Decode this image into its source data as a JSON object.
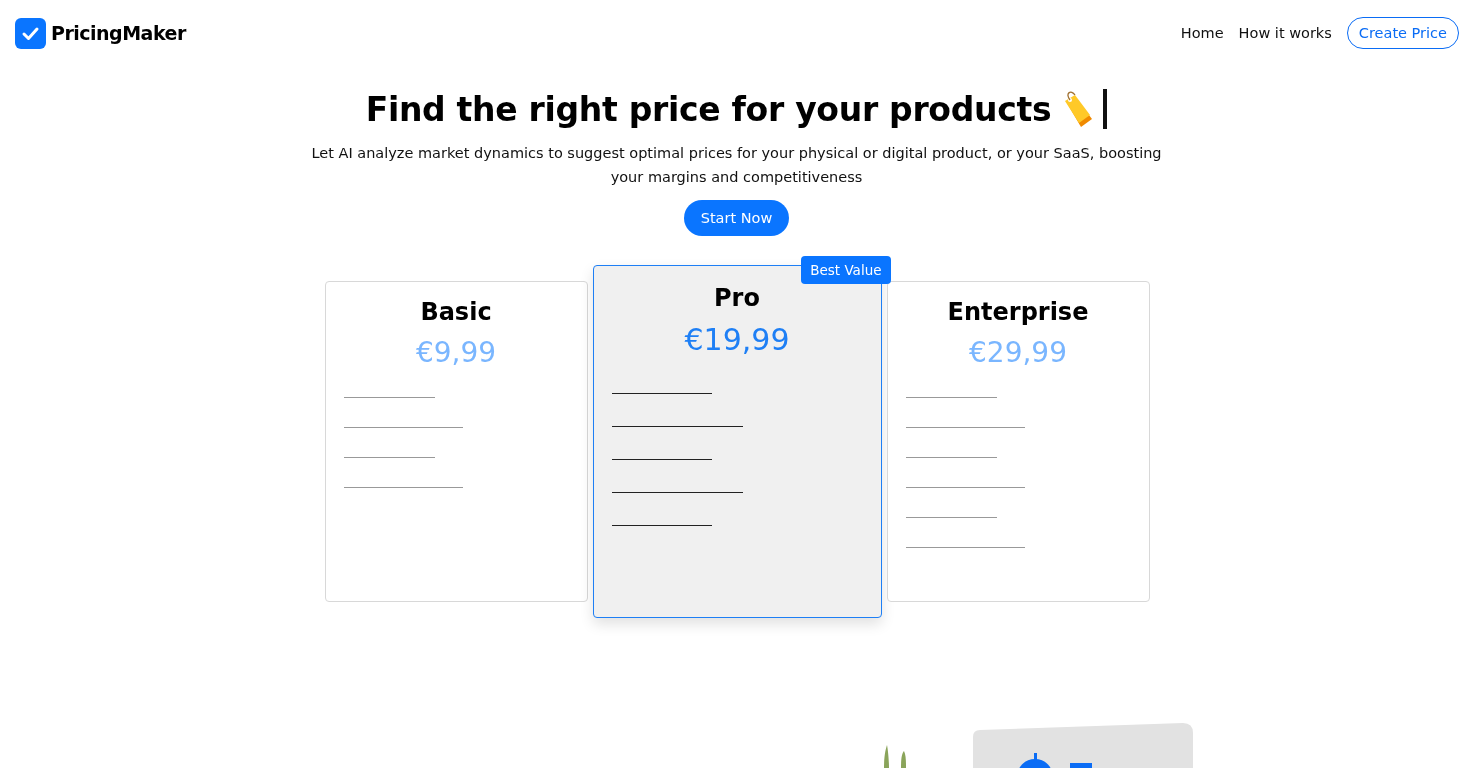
{
  "header": {
    "brand": "PricingMaker",
    "nav": [
      {
        "label": "Home",
        "kind": "link"
      },
      {
        "label": "How it works",
        "kind": "link"
      },
      {
        "label": "Create Price",
        "kind": "outline"
      }
    ]
  },
  "hero": {
    "title": "Find the right price for your products",
    "subtitle": "Let AI analyze market dynamics to suggest optimal prices for your physical or digital product, or your SaaS, boosting your margins and competitiveness",
    "cta": "Start Now"
  },
  "plans": [
    {
      "name": "Basic",
      "price": "€9,99",
      "selected": false,
      "lines": [
        {
          "kind": "short"
        },
        {
          "kind": "long"
        },
        {
          "kind": "short"
        },
        {
          "kind": "long"
        }
      ]
    },
    {
      "name": "Pro",
      "price": "€19,99",
      "selected": true,
      "badge": "Best Value",
      "lines": [
        {
          "kind": "short"
        },
        {
          "kind": "long"
        },
        {
          "kind": "short"
        },
        {
          "kind": "long"
        },
        {
          "kind": "short"
        }
      ]
    },
    {
      "name": "Enterprise",
      "price": "€29,99",
      "selected": false,
      "lines": [
        {
          "kind": "short"
        },
        {
          "kind": "long"
        },
        {
          "kind": "short"
        },
        {
          "kind": "long"
        },
        {
          "kind": "short"
        },
        {
          "kind": "long"
        }
      ]
    }
  ]
}
